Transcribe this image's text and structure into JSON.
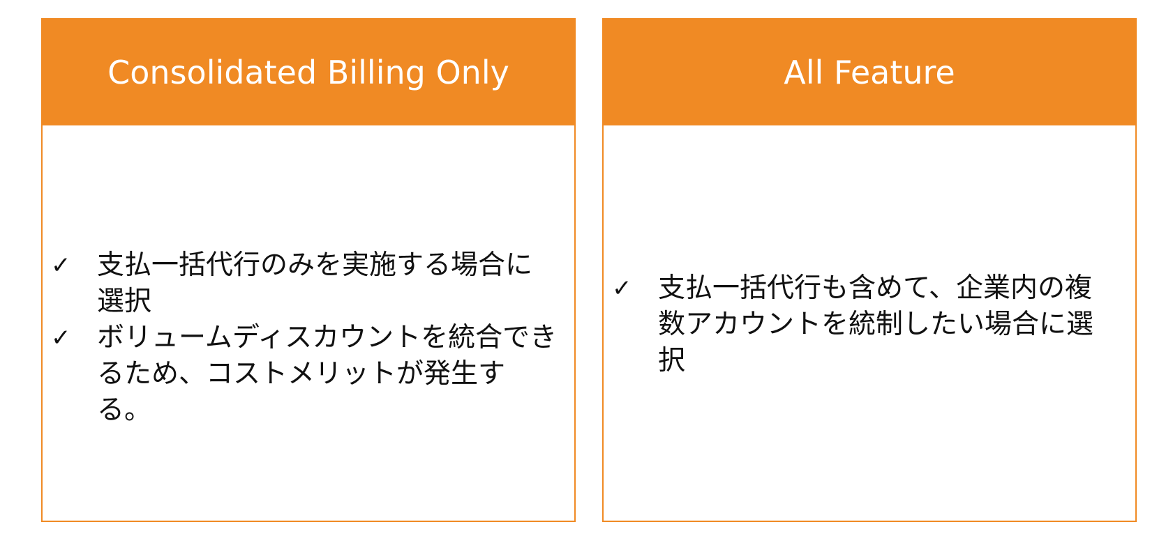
{
  "colors": {
    "accent": "#F08A24",
    "background": "#FFFFFF",
    "text": "#111111",
    "header_text": "#FFFFFF"
  },
  "cards": [
    {
      "title": "Consolidated Billing Only",
      "check_icon": "check-icon",
      "bullets": [
        "支払一括代行のみを実施する場合に選択",
        "ボリュームディスカウントを統合できるため、コストメリットが発生する。"
      ]
    },
    {
      "title": "All Feature",
      "check_icon": "check-icon",
      "bullets": [
        "支払一括代行も含めて、企業内の複数アカウントを統制したい場合に選択"
      ]
    }
  ]
}
